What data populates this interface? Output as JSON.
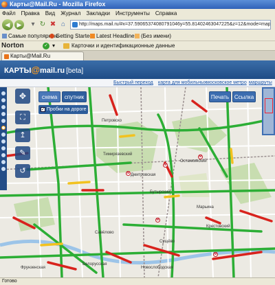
{
  "window": {
    "title": "Карты@Mail.Ru - Mozilla Firefox"
  },
  "menu": [
    "Файл",
    "Правка",
    "Вид",
    "Журнал",
    "Закладки",
    "Инструменты",
    "Справка"
  ],
  "address_bar": {
    "url": "http://maps.mail.ru/#x=37.59065374080791046y=55.81402463047225&z=12&mode=map"
  },
  "bookmarks": [
    "Самые популярные",
    "Getting Started",
    "Latest Headlines",
    "(Без имени)"
  ],
  "norton": {
    "logo": "Norton",
    "cards_label": "Карточки и идентификационные данные"
  },
  "tab": {
    "title": "Карты@Mail.Ru"
  },
  "site": {
    "logo_prefix": "КАРТЫ",
    "logo_at": "@",
    "logo_suffix": "mail.ru",
    "logo_beta": "[beta]",
    "links": [
      "Быстрый переход",
      "карта для мобильных",
      "московское метро",
      "маршруты"
    ]
  },
  "map": {
    "btn_schema": "схема",
    "btn_satellite": "спутник",
    "traffic_label": "Пробки на дороге",
    "btn_print": "Печать",
    "btn_link": "Ссылка",
    "labels": [
      "Петровско",
      "Савёлово",
      "Тимирязевский",
      "Дмитровская",
      "Бутырский",
      "Останкинский",
      "Марьина",
      "Сущёво",
      "Крестовский",
      "Фрунзенская",
      "Белорусская",
      "Новослободская"
    ]
  },
  "status": {
    "text": "Готово"
  },
  "colors": {
    "traffic_green": "#2cae35",
    "traffic_red": "#d8231d",
    "traffic_yellow": "#f2c220",
    "header_blue": "#2a5a96"
  }
}
